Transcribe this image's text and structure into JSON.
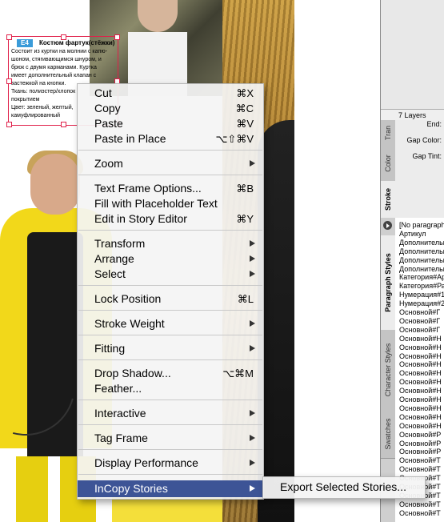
{
  "text_frame": {
    "code": "E4",
    "title": "Костюм фартук(стёжки)",
    "lines": [
      "Состоит из куртки на молнии с капю-",
      "шоном, стягивающимся шнуром, и",
      "брюк с двумя карманами.  Куртка",
      "имеет дополнительный клапан с",
      "застежкой на кнопки.",
      "Ткань: полиэстер/хлопок",
      "покрытием",
      "Цвет: зеленый, желтый,",
      "камуфлированный"
    ]
  },
  "context_menu": {
    "items": [
      {
        "label": "Cut",
        "shortcut": "⌘X"
      },
      {
        "label": "Copy",
        "shortcut": "⌘C"
      },
      {
        "label": "Paste",
        "shortcut": "⌘V"
      },
      {
        "label": "Paste in Place",
        "shortcut": "⌥⇧⌘V"
      },
      {
        "label": "Zoom",
        "shortcut": ""
      },
      {
        "label": "Text Frame Options...",
        "shortcut": "⌘B"
      },
      {
        "label": "Fill with Placeholder Text",
        "shortcut": ""
      },
      {
        "label": "Edit in Story Editor",
        "shortcut": "⌘Y"
      },
      {
        "label": "Transform",
        "shortcut": ""
      },
      {
        "label": "Arrange",
        "shortcut": ""
      },
      {
        "label": "Select",
        "shortcut": ""
      },
      {
        "label": "Lock Position",
        "shortcut": "⌘L"
      },
      {
        "label": "Stroke Weight",
        "shortcut": ""
      },
      {
        "label": "Fitting",
        "shortcut": ""
      },
      {
        "label": "Drop Shadow...",
        "shortcut": "⌥⌘M"
      },
      {
        "label": "Feather...",
        "shortcut": ""
      },
      {
        "label": "Interactive",
        "shortcut": ""
      },
      {
        "label": "Tag Frame",
        "shortcut": ""
      },
      {
        "label": "Display Performance",
        "shortcut": ""
      },
      {
        "label": "InCopy Stories",
        "shortcut": ""
      }
    ],
    "submenu": {
      "label": "Export Selected Stories..."
    }
  },
  "panel": {
    "layers_count": "7 Layers",
    "upper_tabs": [
      "Tran",
      "Color",
      "Stroke"
    ],
    "stroke_fields": [
      "End:",
      "Gap Color:",
      "Gap Tint:"
    ],
    "lower_tabs": [
      "Paragraph Styles",
      "Character Styles",
      "Swatches"
    ],
    "paragraph_styles": [
      "[No paragraph style]",
      "Артикул",
      "Дополнительно",
      "Дополнительно",
      "Дополнительно",
      "Дополнительно",
      "Категория#Артикул",
      "Категория#Раздел",
      "Нумерация#1",
      "Нумерация#2",
      "Основной#Г",
      "Основной#Г",
      "Основной#Г",
      "Основной#Н",
      "Основной#Н",
      "Основной#Н",
      "Основной#Н",
      "Основной#Н",
      "Основной#Н",
      "Основной#Н",
      "Основной#Н",
      "Основной#Н",
      "Основной#Н",
      "Основной#Н",
      "Основной#Р",
      "Основной#Р",
      "Основной#Р",
      "Основной#Т",
      "Основной#Т",
      "Основной#Т",
      "Основной#Т",
      "Основной#Т",
      "Основной#Т",
      "Основной#Т"
    ]
  }
}
